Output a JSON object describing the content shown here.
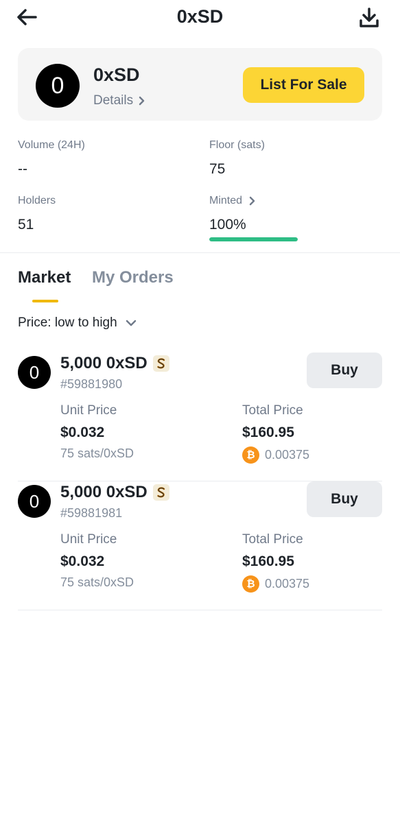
{
  "header": {
    "title": "0xSD",
    "back_icon": "arrow-left-icon",
    "download_icon": "download-icon"
  },
  "token": {
    "avatar_letter": "0",
    "name": "0xSD",
    "details_label": "Details",
    "list_button": "List For Sale"
  },
  "stats": {
    "volume_label": "Volume (24H)",
    "volume_value": "--",
    "floor_label": "Floor (sats)",
    "floor_value": "75",
    "holders_label": "Holders",
    "holders_value": "51",
    "minted_label": "Minted",
    "minted_value": "100%",
    "minted_fraction": 1.0
  },
  "tabs": [
    "Market",
    "My Orders"
  ],
  "sort": {
    "label": "Price: low to high"
  },
  "listings": [
    {
      "avatar_letter": "0",
      "amount": "5,000 0xSD",
      "id": "#59881980",
      "buy_label": "Buy",
      "unit_price_label": "Unit Price",
      "unit_price": "$0.032",
      "unit_sats": "75 sats/0xSD",
      "total_price_label": "Total Price",
      "total_price": "$160.95",
      "total_btc": "0.00375"
    },
    {
      "avatar_letter": "0",
      "amount": "5,000 0xSD",
      "id": "#59881981",
      "buy_label": "Buy",
      "unit_price_label": "Unit Price",
      "unit_price": "$0.032",
      "unit_sats": "75 sats/0xSD",
      "total_price_label": "Total Price",
      "total_price": "$160.95",
      "total_btc": "0.00375"
    }
  ],
  "colors": {
    "accent": "#fcd535",
    "tab_underline": "#f0b90b",
    "progress": "#2ebd85",
    "btc": "#f7931a"
  }
}
